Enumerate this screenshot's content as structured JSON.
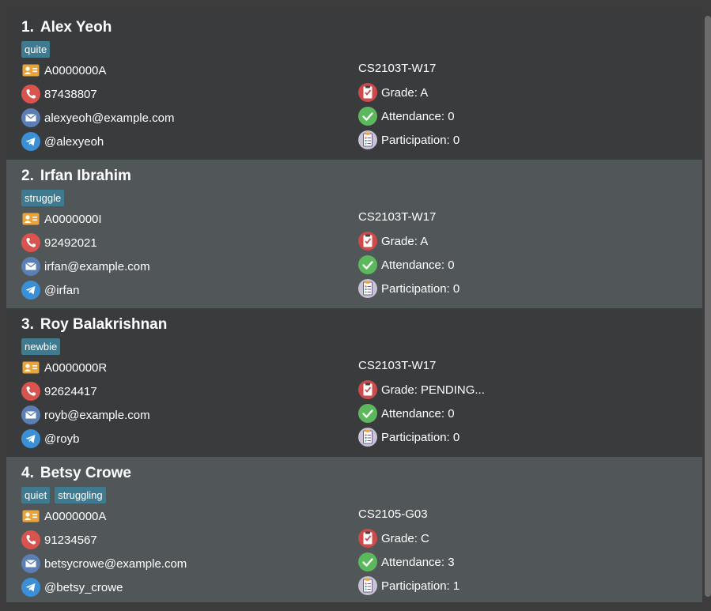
{
  "persons": [
    {
      "index": "1.",
      "name": "Alex Yeoh",
      "tags": [
        "quite"
      ],
      "student_id": "A0000000A",
      "phone": "87438807",
      "email": "alexyeoh@example.com",
      "telegram": "@alexyeoh",
      "group": "CS2103T-W17",
      "grade": "Grade: A",
      "attendance": "Attendance: 0",
      "participation": "Participation: 0"
    },
    {
      "index": "2.",
      "name": "Irfan Ibrahim",
      "tags": [
        "struggle"
      ],
      "student_id": "A0000000I",
      "phone": "92492021",
      "email": "irfan@example.com",
      "telegram": "@irfan",
      "group": "CS2103T-W17",
      "grade": "Grade: A",
      "attendance": "Attendance: 0",
      "participation": "Participation: 0"
    },
    {
      "index": "3.",
      "name": "Roy Balakrishnan",
      "tags": [
        "newbie"
      ],
      "student_id": "A0000000R",
      "phone": "92624417",
      "email": "royb@example.com",
      "telegram": "@royb",
      "group": "CS2103T-W17",
      "grade": "Grade: PENDING...",
      "attendance": "Attendance: 0",
      "participation": "Participation: 0"
    },
    {
      "index": "4.",
      "name": "Betsy Crowe",
      "tags": [
        "quiet",
        "struggling"
      ],
      "student_id": "A0000000A",
      "phone": "91234567",
      "email": "betsycrowe@example.com",
      "telegram": "@betsy_crowe",
      "group": "CS2105-G03",
      "grade": "Grade: C",
      "attendance": "Attendance: 3",
      "participation": "Participation: 1"
    }
  ],
  "icons": {
    "student_id": "id-card-icon",
    "phone": "phone-icon",
    "email": "email-icon",
    "telegram": "telegram-icon",
    "grade": "grade-icon",
    "attendance": "attendance-check-icon",
    "participation": "participation-clipboard-icon"
  },
  "colors": {
    "card_odd": "#3a3b3d",
    "card_even": "#515658",
    "tag": "#3e7b91",
    "phone_icon": "#d9534f",
    "email_icon": "#5b7fb5",
    "telegram_icon": "#3a8fd6",
    "check_icon": "#5cb85c"
  }
}
